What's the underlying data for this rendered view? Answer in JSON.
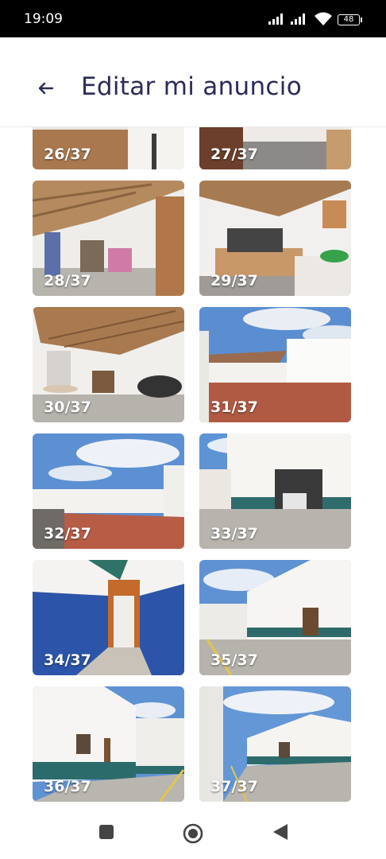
{
  "status_bar": {
    "time": "19:09",
    "battery": "48"
  },
  "header": {
    "title": "Editar mi anuncio"
  },
  "gallery": {
    "tiles": [
      {
        "label": "26/37"
      },
      {
        "label": "27/37"
      },
      {
        "label": "28/37"
      },
      {
        "label": "29/37"
      },
      {
        "label": "30/37"
      },
      {
        "label": "31/37"
      },
      {
        "label": "32/37"
      },
      {
        "label": "33/37"
      },
      {
        "label": "34/37"
      },
      {
        "label": "35/37"
      },
      {
        "label": "36/37"
      },
      {
        "label": "37/37"
      }
    ]
  },
  "nav_bar": {
    "icons": [
      "square-icon",
      "home-circle-icon",
      "back-triangle-icon"
    ]
  },
  "colors": {
    "title": "#2a2c57",
    "status_bar": "#000000"
  }
}
